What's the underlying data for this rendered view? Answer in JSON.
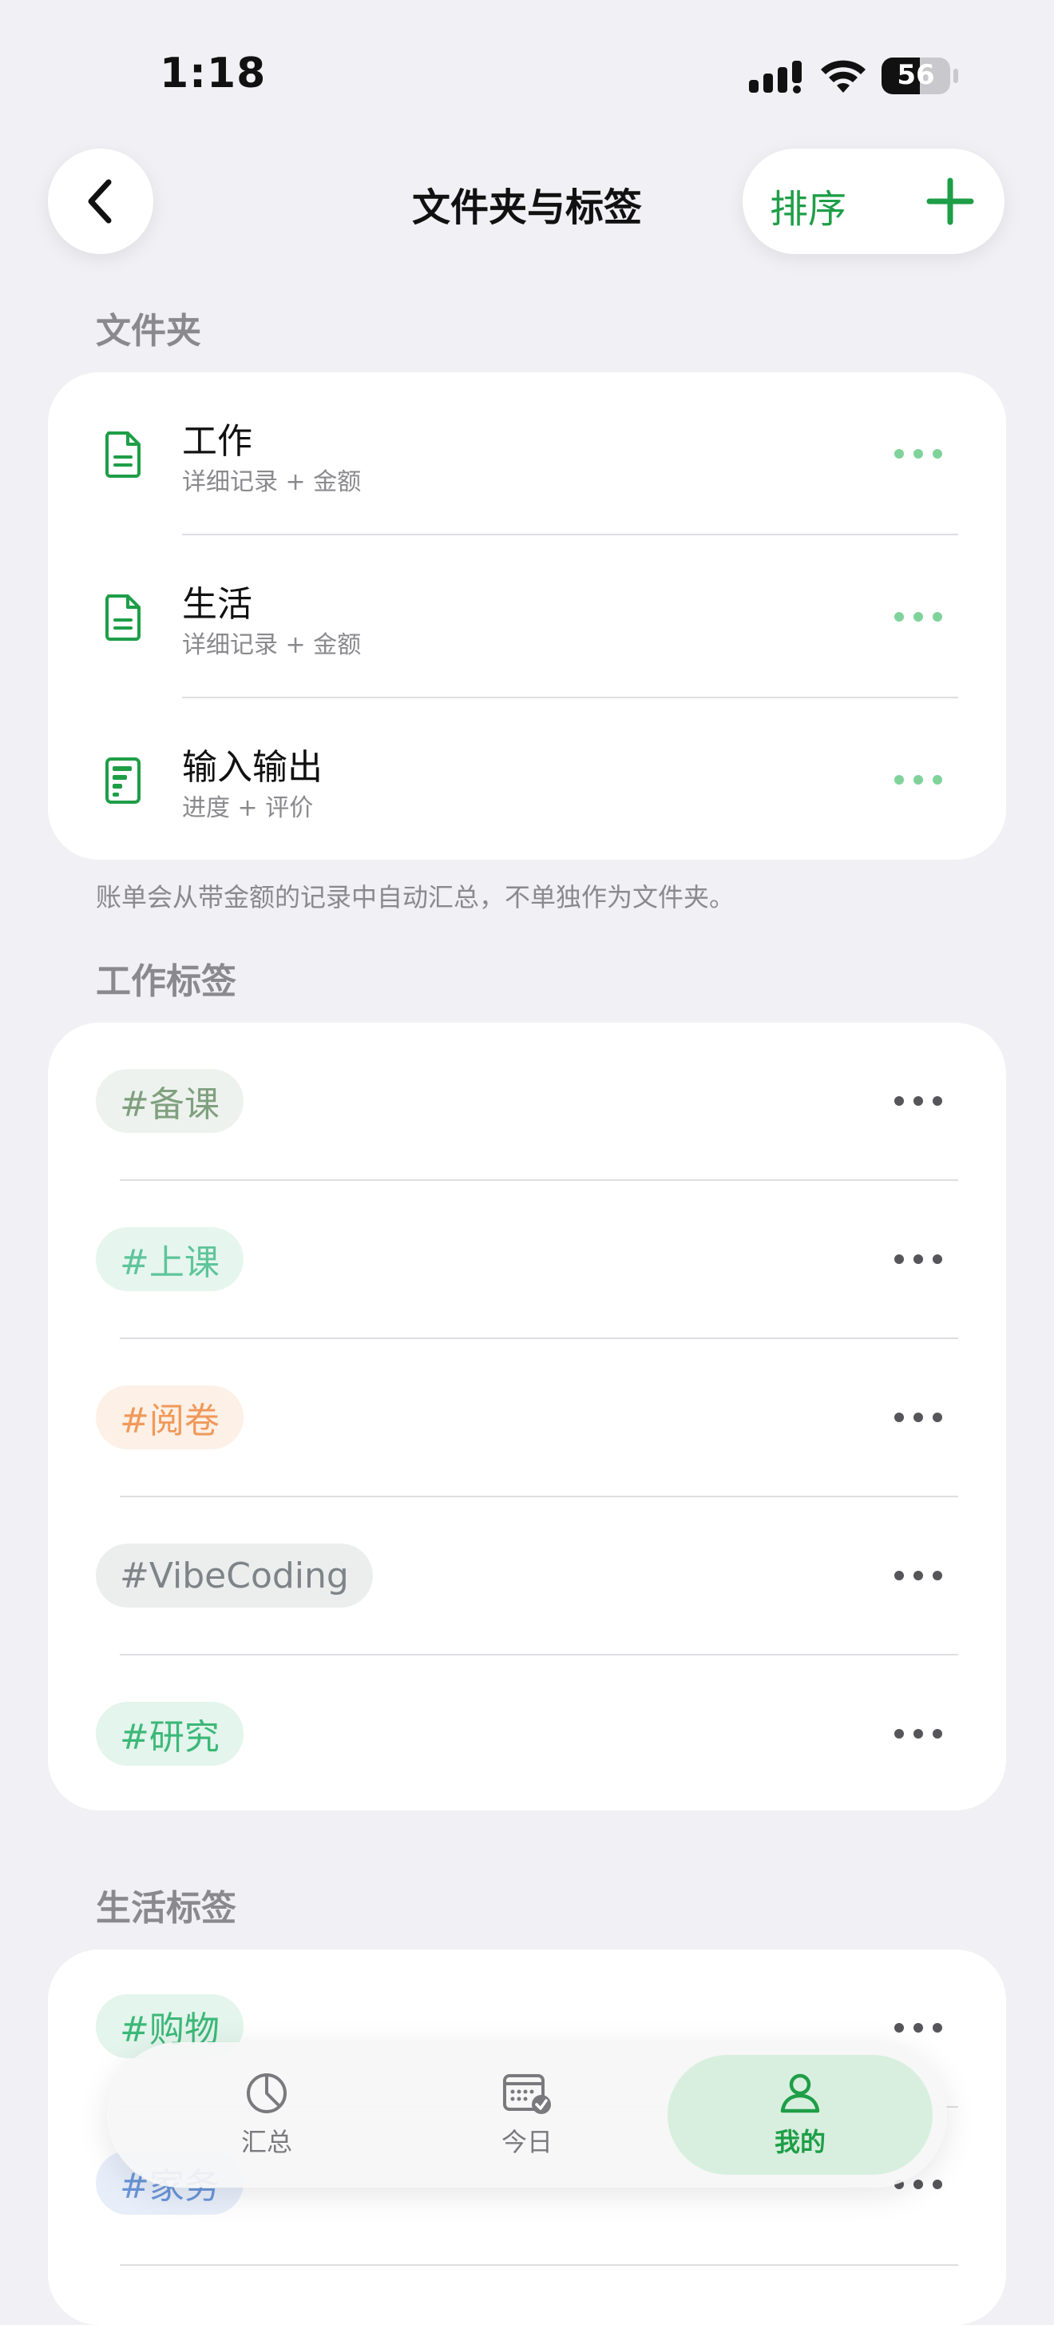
{
  "status_bar": {
    "time": "1:18",
    "battery": "56",
    "battery_level": 0.56
  },
  "nav": {
    "title": "文件夹与标签",
    "sort_label": "排序"
  },
  "folders": {
    "heading": "文件夹",
    "items": [
      {
        "title": "工作",
        "subtitle": "详细记录 + 金额",
        "icon": "document-icon"
      },
      {
        "title": "生活",
        "subtitle": "详细记录 + 金额",
        "icon": "document-icon"
      },
      {
        "title": "输入输出",
        "subtitle": "进度 + 评价",
        "icon": "progress-document-icon"
      }
    ],
    "footnote": "账单会从带金额的记录中自动汇总，不单独作为文件夹。"
  },
  "work_tags": {
    "heading": "工作标签",
    "items": [
      {
        "label": "#备课",
        "color": "#7fa07f",
        "bg": "#eef2ee"
      },
      {
        "label": "#上课",
        "color": "#5fc49a",
        "bg": "#e6f6ef"
      },
      {
        "label": "#阅卷",
        "color": "#f0995a",
        "bg": "#fdf0e6"
      },
      {
        "label": "#VibeCoding",
        "color": "#7e8488",
        "bg": "#eceeee"
      },
      {
        "label": "#研究",
        "color": "#3cb878",
        "bg": "#e3f5ec"
      }
    ]
  },
  "life_tags": {
    "heading": "生活标签",
    "items": [
      {
        "label": "#购物",
        "color": "#3cb878",
        "bg": "#e3f5ec"
      },
      {
        "label": "#家务",
        "color": "#6a95d8",
        "bg": "#e7eefa"
      }
    ]
  },
  "tabbar": {
    "tabs": [
      {
        "label": "汇总",
        "icon": "pie-chart-icon"
      },
      {
        "label": "今日",
        "icon": "calendar-check-icon"
      },
      {
        "label": "我的",
        "icon": "person-icon"
      }
    ],
    "active_index": 2
  },
  "colors": {
    "accent": "#1e9e47",
    "background": "#f1f1f5",
    "secondary_text": "#8a8a8e"
  }
}
